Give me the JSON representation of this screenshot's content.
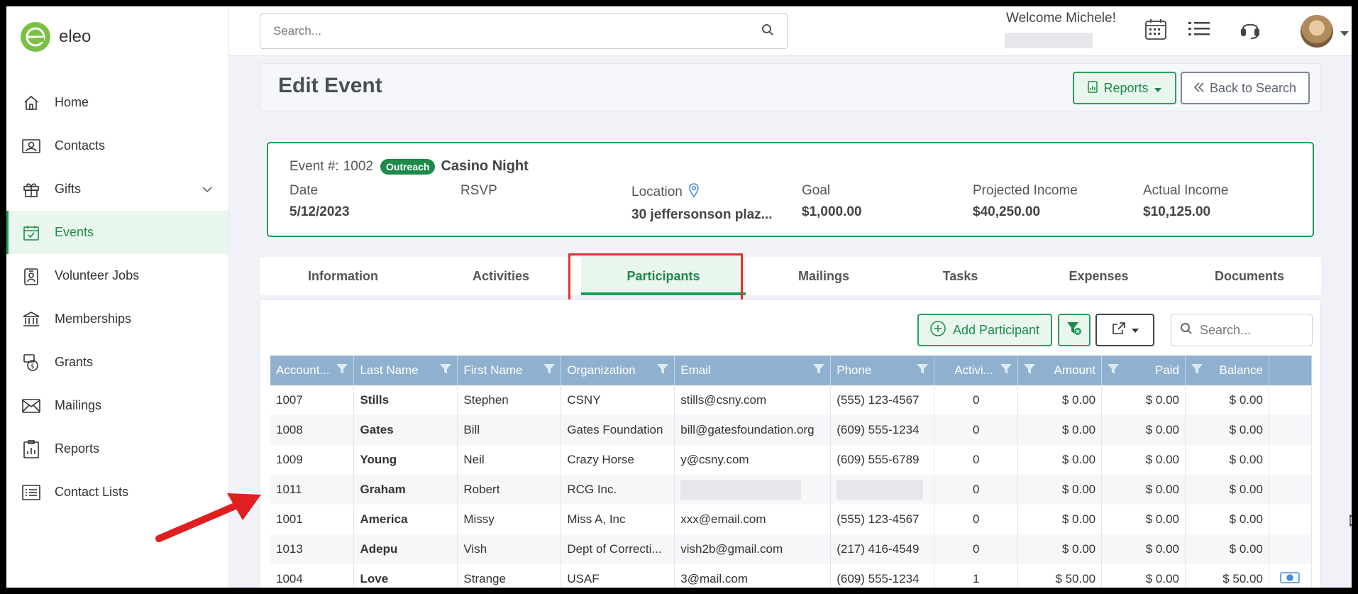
{
  "brand": {
    "name": "eleo",
    "color": "#7ac143"
  },
  "sidebar": {
    "items": [
      {
        "label": "Home",
        "icon": "home-icon"
      },
      {
        "label": "Contacts",
        "icon": "contact-card-icon"
      },
      {
        "label": "Gifts",
        "icon": "gift-icon",
        "expandable": true
      },
      {
        "label": "Events",
        "icon": "calendar-check-icon",
        "active": true
      },
      {
        "label": "Volunteer Jobs",
        "icon": "volunteer-badge-icon"
      },
      {
        "label": "Memberships",
        "icon": "institution-icon"
      },
      {
        "label": "Grants",
        "icon": "grant-money-icon"
      },
      {
        "label": "Mailings",
        "icon": "envelope-icon"
      },
      {
        "label": "Reports",
        "icon": "report-clipboard-icon"
      },
      {
        "label": "Contact Lists",
        "icon": "list-icon"
      }
    ]
  },
  "header": {
    "search_placeholder": "Search...",
    "welcome": "Welcome Michele!"
  },
  "page": {
    "title": "Edit Event",
    "reports_label": "Reports",
    "back_label": "Back to Search"
  },
  "event": {
    "number_label": "Event #:",
    "number": "1002",
    "category": "Outreach",
    "name": "Casino Night",
    "date_label": "Date",
    "date": "5/12/2023",
    "rsvp_label": "RSVP",
    "rsvp": "",
    "location_label": "Location",
    "location": "30 jeffersonson plaz...",
    "goal_label": "Goal",
    "goal": "$1,000.00",
    "projected_label": "Projected Income",
    "projected": "$40,250.00",
    "actual_label": "Actual Income",
    "actual": "$10,125.00"
  },
  "tabs": [
    {
      "label": "Information"
    },
    {
      "label": "Activities"
    },
    {
      "label": "Participants",
      "active": true
    },
    {
      "label": "Mailings"
    },
    {
      "label": "Tasks"
    },
    {
      "label": "Expenses"
    },
    {
      "label": "Documents"
    }
  ],
  "grid": {
    "add_label": "Add Participant",
    "search_placeholder": "Search...",
    "columns": [
      "Account...",
      "Last Name",
      "First Name",
      "Organization",
      "Email",
      "Phone",
      "Activi...",
      "Amount",
      "Paid",
      "Balance"
    ],
    "rows": [
      {
        "account": "1007",
        "last": "Stills",
        "first": "Stephen",
        "org": "CSNY",
        "email": "stills@csny.com",
        "phone": "(555) 123-4567",
        "activities": "0",
        "amount": "$ 0.00",
        "paid": "$ 0.00",
        "balance": "$ 0.00"
      },
      {
        "account": "1008",
        "last": "Gates",
        "first": "Bill",
        "org": "Gates Foundation",
        "email": "bill@gatesfoundation.org",
        "phone": "(609) 555-1234",
        "activities": "0",
        "amount": "$ 0.00",
        "paid": "$ 0.00",
        "balance": "$ 0.00"
      },
      {
        "account": "1009",
        "last": "Young",
        "first": "Neil",
        "org": "Crazy Horse",
        "email": "y@csny.com",
        "phone": "(609) 555-6789",
        "activities": "0",
        "amount": "$ 0.00",
        "paid": "$ 0.00",
        "balance": "$ 0.00"
      },
      {
        "account": "1011",
        "last": "Graham",
        "first": "Robert",
        "org": "RCG Inc.",
        "email": "",
        "phone": "",
        "activities": "0",
        "amount": "$ 0.00",
        "paid": "$ 0.00",
        "balance": "$ 0.00",
        "redacted": true
      },
      {
        "account": "1001",
        "last": "America",
        "first": "Missy",
        "org": "Miss A, Inc",
        "email": "xxx@email.com",
        "phone": "(555) 123-4567",
        "activities": "0",
        "amount": "$ 0.00",
        "paid": "$ 0.00",
        "balance": "$ 0.00"
      },
      {
        "account": "1013",
        "last": "Adepu",
        "first": "Vish",
        "org": "Dept of Correcti...",
        "email": "vish2b@gmail.com",
        "phone": "(217) 416-4549",
        "activities": "0",
        "amount": "$ 0.00",
        "paid": "$ 0.00",
        "balance": "$ 0.00"
      },
      {
        "account": "1004",
        "last": "Love",
        "first": "Strange",
        "org": "USAF",
        "email": "3@mail.com",
        "phone": "(609) 555-1234",
        "activities": "1",
        "amount": "$ 50.00",
        "paid": "$ 0.00",
        "balance": "$ 50.00",
        "has_action": true
      }
    ]
  },
  "colors": {
    "accent": "#1e9f56",
    "header_row": "#8fb0cf",
    "highlight": "#e03030"
  }
}
